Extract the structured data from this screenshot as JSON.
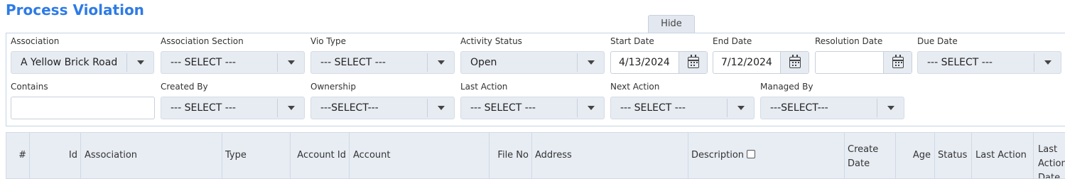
{
  "page": {
    "title": "Process Violation",
    "hide_label": "Hide"
  },
  "filters": {
    "association": {
      "label": "Association",
      "value": "A Yellow Brick Road"
    },
    "association_section": {
      "label": "Association Section",
      "value": "--- SELECT ---"
    },
    "vio_type": {
      "label": "Vio Type",
      "value": "--- SELECT ---"
    },
    "activity_status": {
      "label": "Activity Status",
      "value": "Open"
    },
    "start_date": {
      "label": "Start Date",
      "value": "4/13/2024"
    },
    "end_date": {
      "label": "End Date",
      "value": "7/12/2024"
    },
    "resolution_date": {
      "label": "Resolution Date",
      "value": ""
    },
    "due_date": {
      "label": "Due Date",
      "value": "--- SELECT ---"
    },
    "contains": {
      "label": "Contains",
      "value": ""
    },
    "created_by": {
      "label": "Created By",
      "value": "--- SELECT ---"
    },
    "ownership": {
      "label": "Ownership",
      "value": "---SELECT---"
    },
    "last_action": {
      "label": "Last Action",
      "value": "--- SELECT ---"
    },
    "next_action": {
      "label": "Next Action",
      "value": "--- SELECT ---"
    },
    "managed_by": {
      "label": "Managed By",
      "value": "---SELECT---"
    }
  },
  "grid": {
    "columns": [
      "#",
      "Id",
      "Association",
      "Type",
      "Account Id",
      "Account",
      "File No",
      "Address",
      "Description",
      "Create Date",
      "Age",
      "Status",
      "Last Action",
      "Last Action Date"
    ]
  },
  "icons": {
    "dropdown": "chevron-down-icon",
    "calendar": "calendar-icon",
    "checkbox": "checkbox-icon"
  }
}
